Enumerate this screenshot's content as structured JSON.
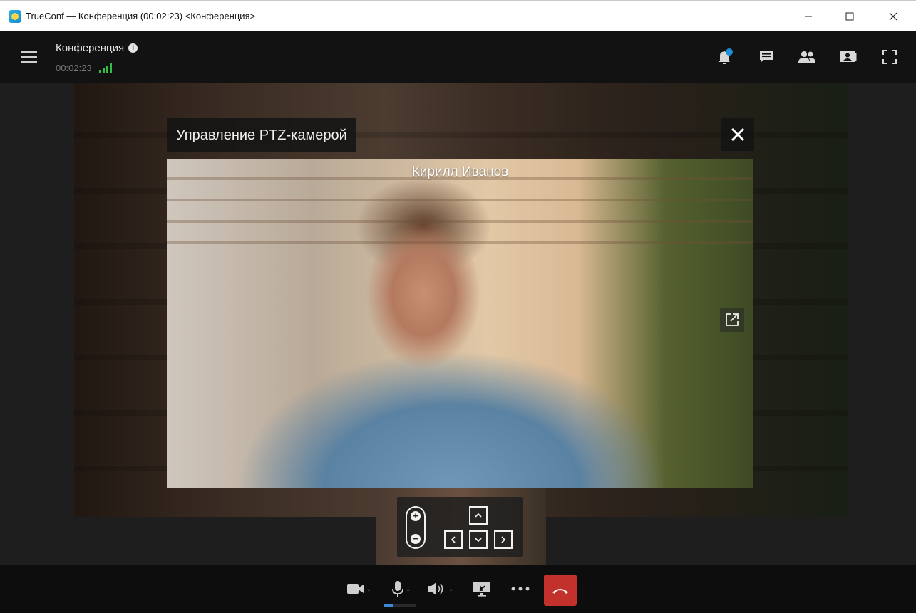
{
  "window": {
    "title": "TrueConf — Конференция (00:02:23) <Конференция>",
    "app_icon": "trueconf-logo-icon",
    "controls": [
      "minimize-icon",
      "maximize-icon",
      "close-icon"
    ]
  },
  "header": {
    "conference_name": "Конференция",
    "timer": "00:02:23",
    "icons": [
      "menu-icon",
      "info-icon",
      "signal-icon",
      "notifications-icon",
      "chat-icon",
      "participants-icon",
      "content-icon",
      "fullscreen-icon"
    ],
    "notification_dot_color": "#1e8fd6",
    "signal_color": "#2fbf4b"
  },
  "ptz": {
    "title": "Управление PTZ-камерой",
    "participant_name": "Кирилл Иванов",
    "zoom_in": "+",
    "zoom_out": "−"
  },
  "toolbar": {
    "icons": [
      "camera-icon",
      "microphone-icon",
      "speaker-icon",
      "share-screen-icon",
      "more-icon",
      "hangup-icon"
    ],
    "hangup_color": "#c2312c"
  }
}
